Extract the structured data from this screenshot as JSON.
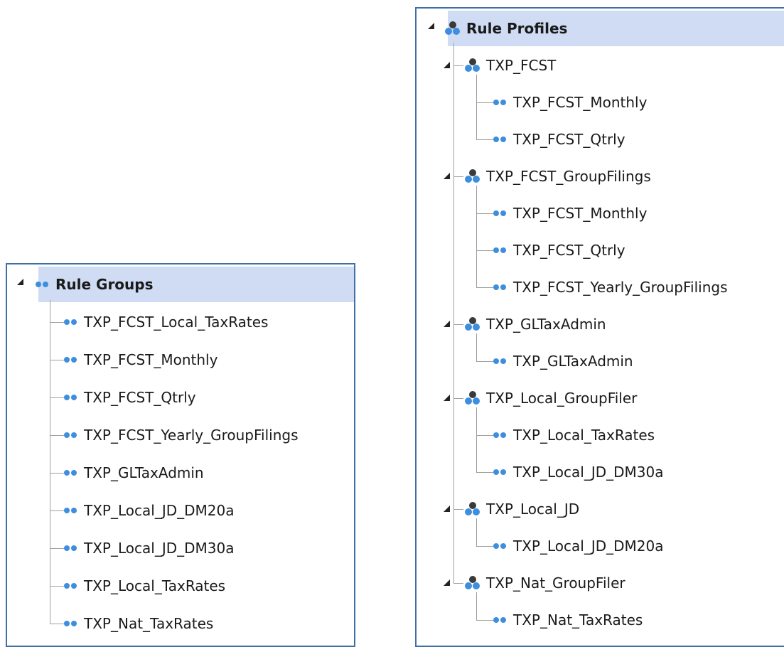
{
  "rule_groups": {
    "title": "Rule Groups",
    "items": [
      "TXP_FCST_Local_TaxRates",
      "TXP_FCST_Monthly",
      "TXP_FCST_Qtrly",
      "TXP_FCST_Yearly_GroupFilings",
      "TXP_GLTaxAdmin",
      "TXP_Local_JD_DM20a",
      "TXP_Local_JD_DM30a",
      "TXP_Local_TaxRates",
      "TXP_Nat_TaxRates"
    ]
  },
  "rule_profiles": {
    "title": "Rule Profiles",
    "profiles": [
      {
        "name": "TXP_FCST",
        "groups": [
          "TXP_FCST_Monthly",
          "TXP_FCST_Qtrly"
        ]
      },
      {
        "name": "TXP_FCST_GroupFilings",
        "groups": [
          "TXP_FCST_Monthly",
          "TXP_FCST_Qtrly",
          "TXP_FCST_Yearly_GroupFilings"
        ]
      },
      {
        "name": "TXP_GLTaxAdmin",
        "groups": [
          "TXP_GLTaxAdmin"
        ]
      },
      {
        "name": "TXP_Local_GroupFiler",
        "groups": [
          "TXP_Local_TaxRates",
          "TXP_Local_JD_DM30a"
        ]
      },
      {
        "name": "TXP_Local_JD",
        "groups": [
          "TXP_Local_JD_DM20a"
        ]
      },
      {
        "name": "TXP_Nat_GroupFiler",
        "groups": [
          "TXP_Nat_TaxRates"
        ]
      }
    ]
  },
  "colors": {
    "header_bg": "#cfdcf3",
    "border": "#3f6fa6",
    "icon_blue": "#3e8ede",
    "icon_dark": "#3a3a3a"
  },
  "icons": {
    "group": "two-dot-group-icon",
    "profile": "three-dot-profile-icon",
    "expander": "expanded-triangle-icon"
  }
}
